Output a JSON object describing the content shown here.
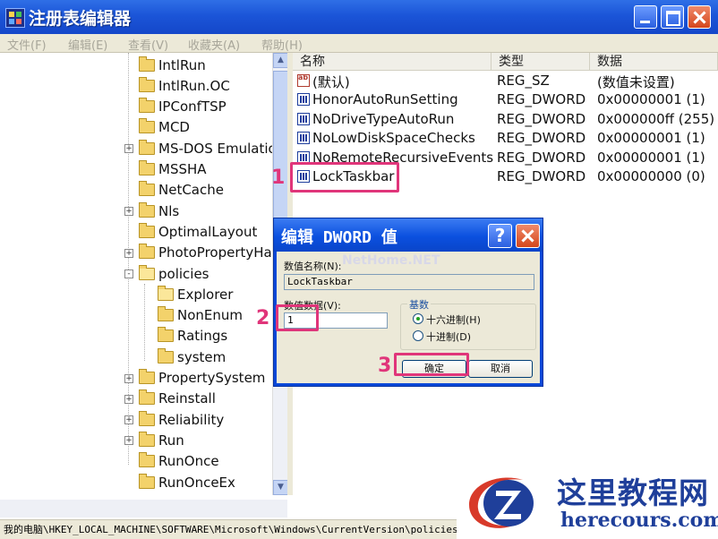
{
  "window": {
    "title": "注册表编辑器"
  },
  "menu": [
    "文件(F)",
    "编辑(E)",
    "查看(V)",
    "收藏夹(A)",
    "帮助(H)"
  ],
  "tree": [
    {
      "label": "IntlRun",
      "expander": ""
    },
    {
      "label": "IntlRun.OC",
      "expander": ""
    },
    {
      "label": "IPConfTSP",
      "expander": ""
    },
    {
      "label": "MCD",
      "expander": ""
    },
    {
      "label": "MS-DOS Emulation",
      "expander": "+"
    },
    {
      "label": "MSSHA",
      "expander": ""
    },
    {
      "label": "NetCache",
      "expander": ""
    },
    {
      "label": "Nls",
      "expander": "+"
    },
    {
      "label": "OptimalLayout",
      "expander": ""
    },
    {
      "label": "PhotoPropertyHandler",
      "expander": "+"
    },
    {
      "label": "policies",
      "expander": "-"
    },
    {
      "label": "Explorer",
      "expander": ""
    },
    {
      "label": "NonEnum",
      "expander": ""
    },
    {
      "label": "Ratings",
      "expander": ""
    },
    {
      "label": "system",
      "expander": ""
    },
    {
      "label": "PropertySystem",
      "expander": "+"
    },
    {
      "label": "Reinstall",
      "expander": "+"
    },
    {
      "label": "Reliability",
      "expander": "+"
    },
    {
      "label": "Run",
      "expander": "+"
    },
    {
      "label": "RunOnce",
      "expander": ""
    },
    {
      "label": "RunOnceEx",
      "expander": ""
    }
  ],
  "columns": {
    "name": "名称",
    "type": "类型",
    "data": "数据"
  },
  "values": [
    {
      "name": "(默认)",
      "type": "REG_SZ",
      "data": "(数值未设置)",
      "icon": "string-value-icon"
    },
    {
      "name": "HonorAutoRunSetting",
      "type": "REG_DWORD",
      "data": "0x00000001 (1)",
      "icon": "dword-value-icon"
    },
    {
      "name": "NoDriveTypeAutoRun",
      "type": "REG_DWORD",
      "data": "0x000000ff (255)",
      "icon": "dword-value-icon"
    },
    {
      "name": "NoLowDiskSpaceChecks",
      "type": "REG_DWORD",
      "data": "0x00000001 (1)",
      "icon": "dword-value-icon"
    },
    {
      "name": "NoRemoteRecursiveEvents",
      "type": "REG_DWORD",
      "data": "0x00000001 (1)",
      "icon": "dword-value-icon"
    },
    {
      "name": "LockTaskbar",
      "type": "REG_DWORD",
      "data": "0x00000000 (0)",
      "icon": "dword-value-icon"
    }
  ],
  "status": "我的电脑\\HKEY_LOCAL_MACHINE\\SOFTWARE\\Microsoft\\Windows\\CurrentVersion\\policies\\",
  "dialog": {
    "title": "编辑 DWORD 值",
    "name_label": "数值名称(N):",
    "name_value": "LockTaskbar",
    "data_label": "数值数据(V):",
    "data_value": "1",
    "base_label": "基数",
    "hex_label": "十六进制(H)",
    "dec_label": "十进制(D)",
    "ok_label": "确定",
    "cancel_label": "取消",
    "selected_base": "hex"
  },
  "annotations": {
    "step1": "1",
    "step2": "2",
    "step3": "3"
  },
  "watermark": "NetHome.NET",
  "brand": {
    "cn": "这里教程网",
    "en": "herecours.com"
  },
  "colors": {
    "title_blue": "#1b55d8",
    "highlight_pink": "#e0357a",
    "brand_blue": "#1f3f9a"
  }
}
